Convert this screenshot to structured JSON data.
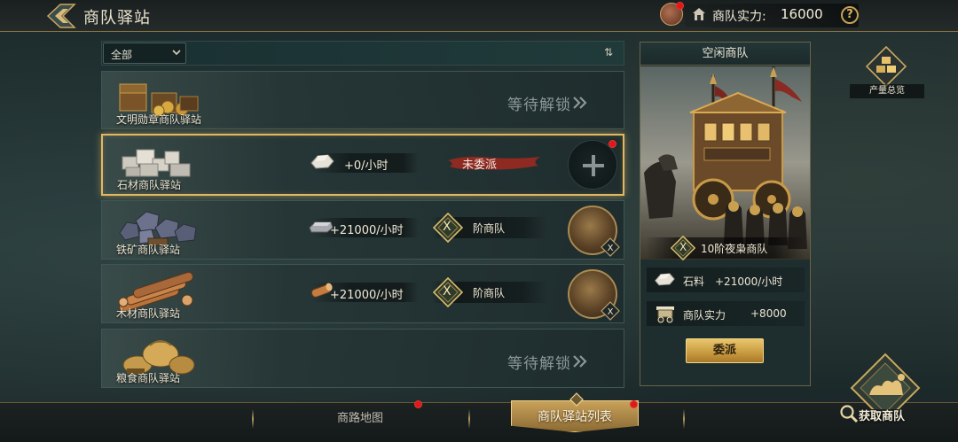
{
  "header": {
    "title": "商队驿站",
    "power_label": "商队实力:",
    "power_value": "16000",
    "help": "?"
  },
  "filter": {
    "selected": "全部",
    "sort_icon": "⇅"
  },
  "stations": [
    {
      "name": "文明勋章商队驿站",
      "status": "等待解锁",
      "icon": "medal-chest-icon"
    },
    {
      "name": "石材商队驿站",
      "rate": "+0/小时",
      "status": "未委派",
      "icon": "stone-icon"
    },
    {
      "name": "铁矿商队驿站",
      "rate": "+21000/小时",
      "tier_numeral": "X",
      "tier_label": "阶商队",
      "icon": "iron-ore-icon"
    },
    {
      "name": "木材商队驿站",
      "rate": "+21000/小时",
      "tier_numeral": "X",
      "tier_label": "阶商队",
      "icon": "wood-icon"
    },
    {
      "name": "粮食商队驿站",
      "status": "等待解锁",
      "icon": "grain-icon"
    }
  ],
  "panel": {
    "title": "空闲商队",
    "tier_numeral": "X",
    "caravan_name": "10阶夜枭商队",
    "stats": [
      {
        "label": "石料",
        "value": "+21000/小时",
        "icon": "stone-icon"
      },
      {
        "label": "商队实力",
        "value": "+8000",
        "icon": "wagon-icon"
      }
    ],
    "dispatch_label": "委派"
  },
  "side": {
    "overview_label": "产量总览"
  },
  "bottom": {
    "tab_map": "商路地图",
    "tab_list": "商队驿站列表",
    "get_caravan": "获取商队"
  },
  "colors": {
    "accent_gold": "#e0b864",
    "notify_red": "#e01818",
    "panel_bg": "#1e2d2e"
  }
}
